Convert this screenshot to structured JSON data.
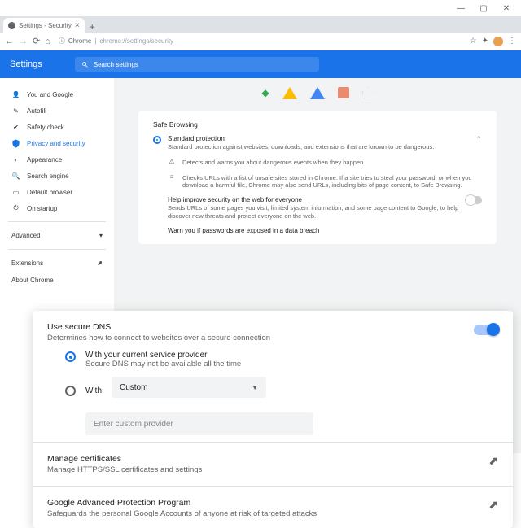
{
  "window": {
    "tab_title": "Settings - Security"
  },
  "omnibox": {
    "prefix": "Chrome",
    "url": "chrome://settings/security"
  },
  "header": {
    "app_title": "Settings",
    "search_placeholder": "Search settings"
  },
  "sidebar": {
    "items": [
      {
        "label": "You and Google"
      },
      {
        "label": "Autofill"
      },
      {
        "label": "Safety check"
      },
      {
        "label": "Privacy and security"
      },
      {
        "label": "Appearance"
      },
      {
        "label": "Search engine"
      },
      {
        "label": "Default browser"
      },
      {
        "label": "On startup"
      }
    ],
    "advanced": "Advanced",
    "extensions": "Extensions",
    "about": "About Chrome"
  },
  "safe_browsing": {
    "section_title": "Safe Browsing",
    "standard_title": "Standard protection",
    "standard_desc": "Standard protection against websites, downloads, and extensions that are known to be dangerous.",
    "detect_desc": "Detects and warns you about dangerous events when they happen",
    "url_check_desc": "Checks URLs with a list of unsafe sites stored in Chrome. If a site tries to steal your password, or when you download a harmful file, Chrome may also send URLs, including bits of page content, to Safe Browsing.",
    "help_title": "Help improve security on the web for everyone",
    "help_desc": "Sends URLs of some pages you visit, limited system information, and some page content to Google, to help discover new threats and protect everyone on the web.",
    "warn_title": "Warn you if passwords are exposed in a data breach"
  },
  "secure_dns": {
    "title": "Use secure DNS",
    "desc": "Determines how to connect to websites over a secure connection",
    "opt1_title": "With your current service provider",
    "opt1_desc": "Secure DNS may not be available all the time",
    "opt2_label": "With",
    "select_value": "Custom",
    "input_placeholder": "Enter custom provider"
  },
  "certs": {
    "title": "Manage certificates",
    "desc": "Manage HTTPS/SSL certificates and settings"
  },
  "gapp": {
    "title": "Google Advanced Protection Program",
    "desc": "Safeguards the personal Google Accounts of anyone at risk of targeted attacks"
  },
  "bg_partial": {
    "desc": "Safeguards the personal Google Accounts of anyone at risk of targeted attacks"
  }
}
